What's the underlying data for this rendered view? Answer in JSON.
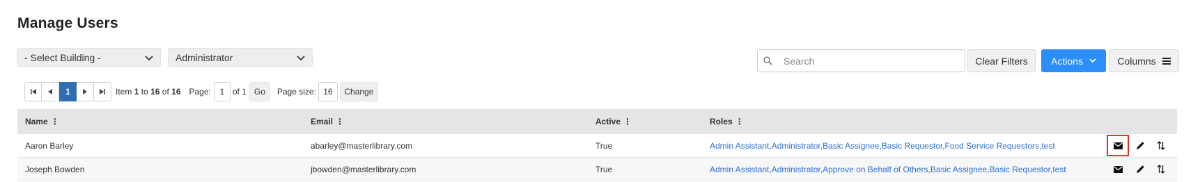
{
  "page": {
    "title": "Manage Users"
  },
  "filters": {
    "building": {
      "value": "- Select Building -",
      "icon": "chevron-down"
    },
    "role": {
      "value": "Administrator",
      "icon": "chevron-down"
    }
  },
  "search": {
    "placeholder": "Search",
    "value": "",
    "icon": "search"
  },
  "toolbar": {
    "clear_filters_label": "Clear Filters",
    "actions_label": "Actions",
    "actions_icon": "chevron-down",
    "columns_label": "Columns",
    "columns_icon": "menu-bars",
    "primary_color": "#2c8ef8"
  },
  "pager": {
    "current_page": "1",
    "item_prefix": "Item",
    "item_from": "1",
    "item_to_word": "to",
    "item_to": "16",
    "item_of_word": "of",
    "item_total": "16",
    "page_label": "Page:",
    "page_value": "1",
    "of_pages": "of 1",
    "go_label": "Go",
    "page_size_label": "Page size:",
    "page_size_value": "16",
    "change_label": "Change"
  },
  "table": {
    "columns": [
      "Name",
      "Email",
      "Active",
      "Roles"
    ],
    "rows": [
      {
        "name": "Aaron Barley",
        "email": "abarley@masterlibrary.com",
        "active": "True",
        "roles": "Admin Assistant,Administrator,Basic Assignee,Basic Requestor,Food Service Requestors,test"
      },
      {
        "name": "Joseph Bowden",
        "email": "jbowden@masterlibrary.com",
        "active": "True",
        "roles": "Admin Assistant,Administrator,Approve on Behalf of Others,Basic Assignee,Basic Requestor,test"
      }
    ],
    "row_action_icons": [
      "envelope",
      "pencil",
      "sort-arrows"
    ],
    "link_color": "#2e6fd1"
  }
}
